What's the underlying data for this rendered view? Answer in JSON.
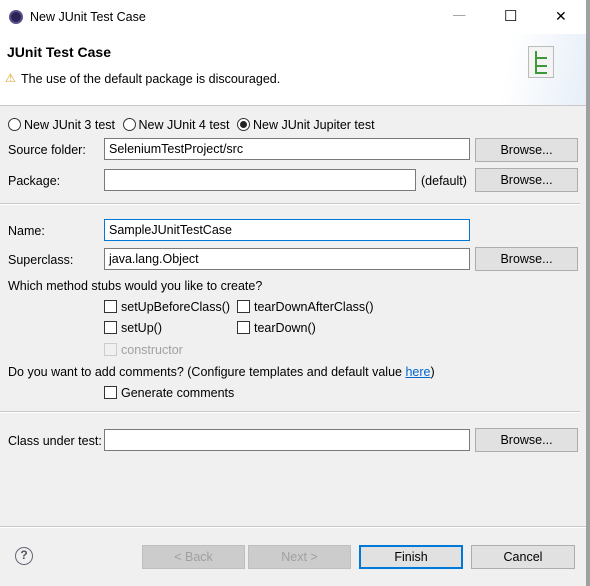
{
  "window": {
    "title": "New JUnit Test Case",
    "minimize": "—",
    "maximize": "☐",
    "close": "✕"
  },
  "header": {
    "title": "JUnit Test Case",
    "warning": "The use of the default package is discouraged."
  },
  "version_radios": [
    {
      "label": "New JUnit 3 test",
      "selected": false
    },
    {
      "label": "New JUnit 4 test",
      "selected": false
    },
    {
      "label": "New JUnit Jupiter test",
      "selected": true
    }
  ],
  "form": {
    "source_folder": {
      "label": "Source folder:",
      "value": "SeleniumTestProject/src",
      "browse": "Browse..."
    },
    "package": {
      "label": "Package:",
      "value": "",
      "suffix": "(default)",
      "browse": "Browse..."
    },
    "name": {
      "label": "Name:",
      "value": "SampleJUnitTestCase"
    },
    "superclass": {
      "label": "Superclass:",
      "value": "java.lang.Object",
      "browse": "Browse..."
    },
    "stubs_question": "Which method stubs would you like to create?",
    "stubs": [
      {
        "label": "setUpBeforeClass()",
        "checked": false
      },
      {
        "label": "tearDownAfterClass()",
        "checked": false
      },
      {
        "label": "setUp()",
        "checked": false
      },
      {
        "label": "tearDown()",
        "checked": false
      },
      {
        "label": "constructor",
        "checked": false,
        "disabled": true
      }
    ],
    "comments_question": "Do you want to add comments? (Configure templates and default value ",
    "comments_link": "here",
    "comments_close": ")",
    "generate_comments": {
      "label": "Generate comments",
      "checked": false
    },
    "class_under_test": {
      "label": "Class under test:",
      "value": "",
      "browse": "Browse..."
    }
  },
  "footer": {
    "help": "?",
    "back": "< Back",
    "next": "Next >",
    "finish": "Finish",
    "cancel": "Cancel"
  },
  "colors": {
    "link": "#0066cc",
    "finish_border": "#0078d7",
    "disabled_btn": "#cccccc"
  }
}
